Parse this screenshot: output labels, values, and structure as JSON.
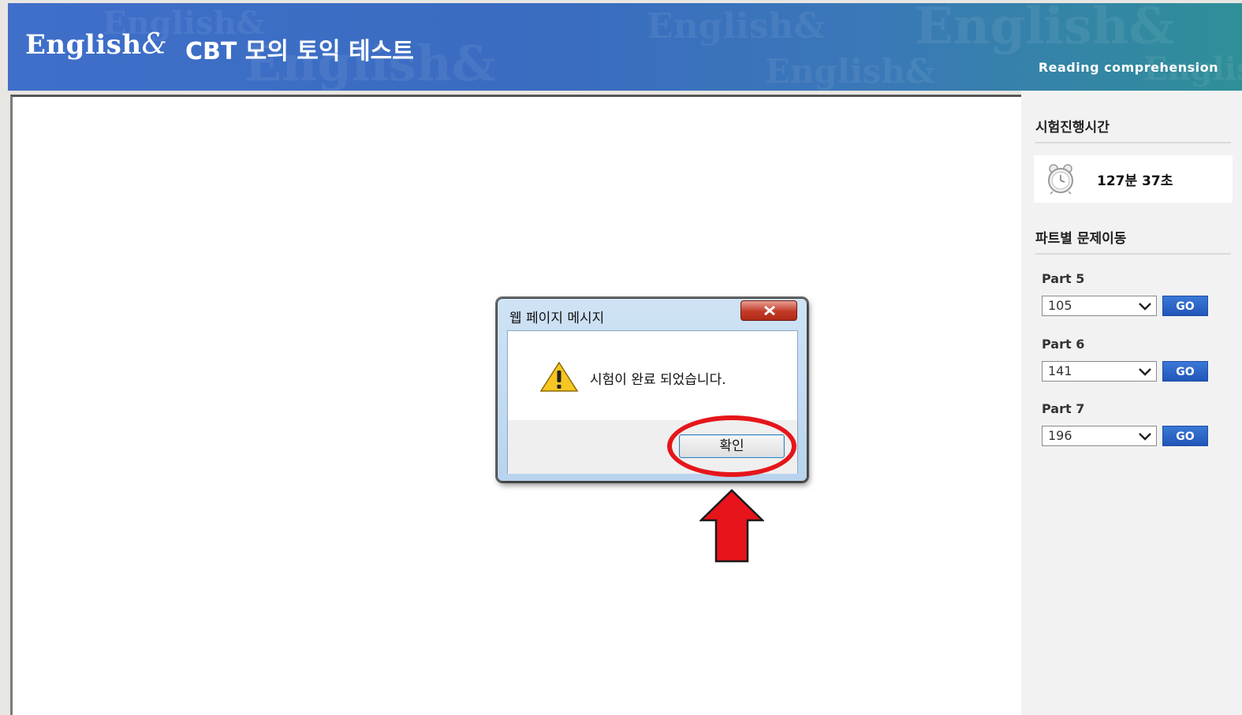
{
  "header": {
    "logo_text": "English",
    "logo_amp": "&",
    "title": "CBT 모의 토익 테스트",
    "section": "Reading comprehension",
    "watermark": "English&"
  },
  "sidebar": {
    "timer_heading": "시험진행시간",
    "timer_value": "127분 37초",
    "nav_heading": "파트별 문제이동",
    "parts": [
      {
        "label": "Part 5",
        "selected": "105",
        "go_label": "GO"
      },
      {
        "label": "Part 6",
        "selected": "141",
        "go_label": "GO"
      },
      {
        "label": "Part 7",
        "selected": "196",
        "go_label": "GO"
      }
    ]
  },
  "dialog": {
    "title": "웹 페이지 메시지",
    "message": "시험이 완료 되었습니다.",
    "ok_label": "확인"
  },
  "annotation": {
    "color": "#e5161b"
  },
  "colors": {
    "header_start": "#3f6fc9",
    "header_end": "#2f8f98",
    "go_button": "#2a62c4"
  }
}
